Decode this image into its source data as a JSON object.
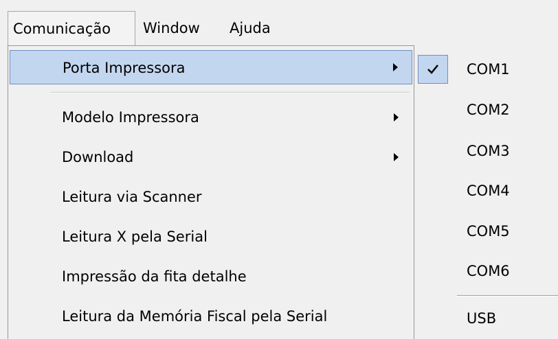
{
  "menubar": {
    "items": [
      {
        "label": "Comunicação"
      },
      {
        "label": "Window"
      },
      {
        "label": "Ajuda"
      }
    ]
  },
  "dropdown": {
    "items": [
      {
        "label": "Porta Impressora",
        "has_submenu": true,
        "highlighted": true
      },
      {
        "label": "Modelo Impressora",
        "has_submenu": true
      },
      {
        "label": "Download",
        "has_submenu": true
      },
      {
        "label": "Leitura via Scanner"
      },
      {
        "label": "Leitura X pela Serial"
      },
      {
        "label": "Impressão da fita detalhe"
      },
      {
        "label": "Leitura da Memória Fiscal pela Serial"
      }
    ]
  },
  "submenu": {
    "items": [
      {
        "label": "COM1",
        "checked": true
      },
      {
        "label": "COM2"
      },
      {
        "label": "COM3"
      },
      {
        "label": "COM4"
      },
      {
        "label": "COM5"
      },
      {
        "label": "COM6"
      },
      {
        "label": "USB"
      }
    ]
  },
  "icons": {
    "submenu_arrow": "chevron-right-icon",
    "check": "check-icon"
  },
  "colors": {
    "highlight_bg": "#c3d6f0",
    "highlight_border": "#6d8fbf",
    "menu_bg": "#f0f0f0"
  }
}
